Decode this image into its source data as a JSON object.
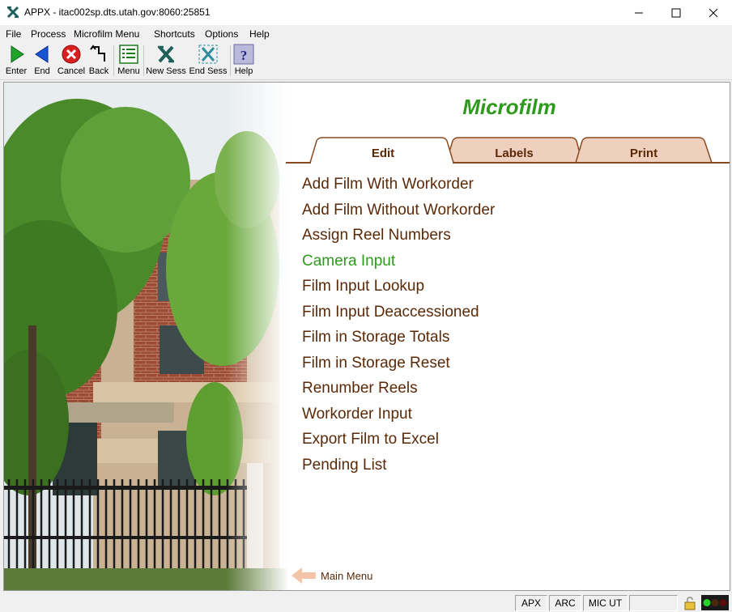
{
  "window": {
    "title": "APPX - itac002sp.dts.utah.gov:8060:25851"
  },
  "menubar": {
    "items": [
      "File",
      "Process",
      "Microfilm Menu",
      "Shortcuts",
      "Options",
      "Help"
    ]
  },
  "toolbar": {
    "buttons": [
      {
        "label": "Enter",
        "icon": "green-play-icon"
      },
      {
        "label": "End",
        "icon": "blue-back-arrow-icon"
      },
      {
        "label": "Cancel",
        "icon": "red-x-icon"
      },
      {
        "label": "Back",
        "icon": "back-step-icon"
      },
      {
        "label": "Menu",
        "icon": "menu-list-icon"
      },
      {
        "label": "New Sess",
        "icon": "new-session-icon"
      },
      {
        "label": "End Sess",
        "icon": "end-session-icon"
      },
      {
        "label": "Help",
        "icon": "help-question-icon"
      }
    ]
  },
  "main": {
    "title": "Microfilm",
    "tabs": [
      {
        "label": "Edit",
        "selected": true
      },
      {
        "label": "Labels",
        "selected": false
      },
      {
        "label": "Print",
        "selected": false
      }
    ],
    "items": [
      "Add Film With Workorder",
      "Add Film Without Workorder",
      "Assign Reel Numbers",
      "Camera Input",
      "Film Input Lookup",
      "Film Input Deaccessioned",
      "Film in Storage Totals",
      "Film in Storage Reset",
      "Renumber Reels",
      "Workorder Input",
      "Export Film to Excel",
      "Pending List"
    ],
    "highlighted_item": "Camera Input",
    "back_link": "Main Menu"
  },
  "statusbar": {
    "cells": [
      "APX",
      "ARC",
      "MIC UT",
      ""
    ]
  },
  "colors": {
    "accent_green": "#2d9a1b",
    "text_brown": "#5a2a08",
    "tab_fill": "#efcfbd"
  }
}
